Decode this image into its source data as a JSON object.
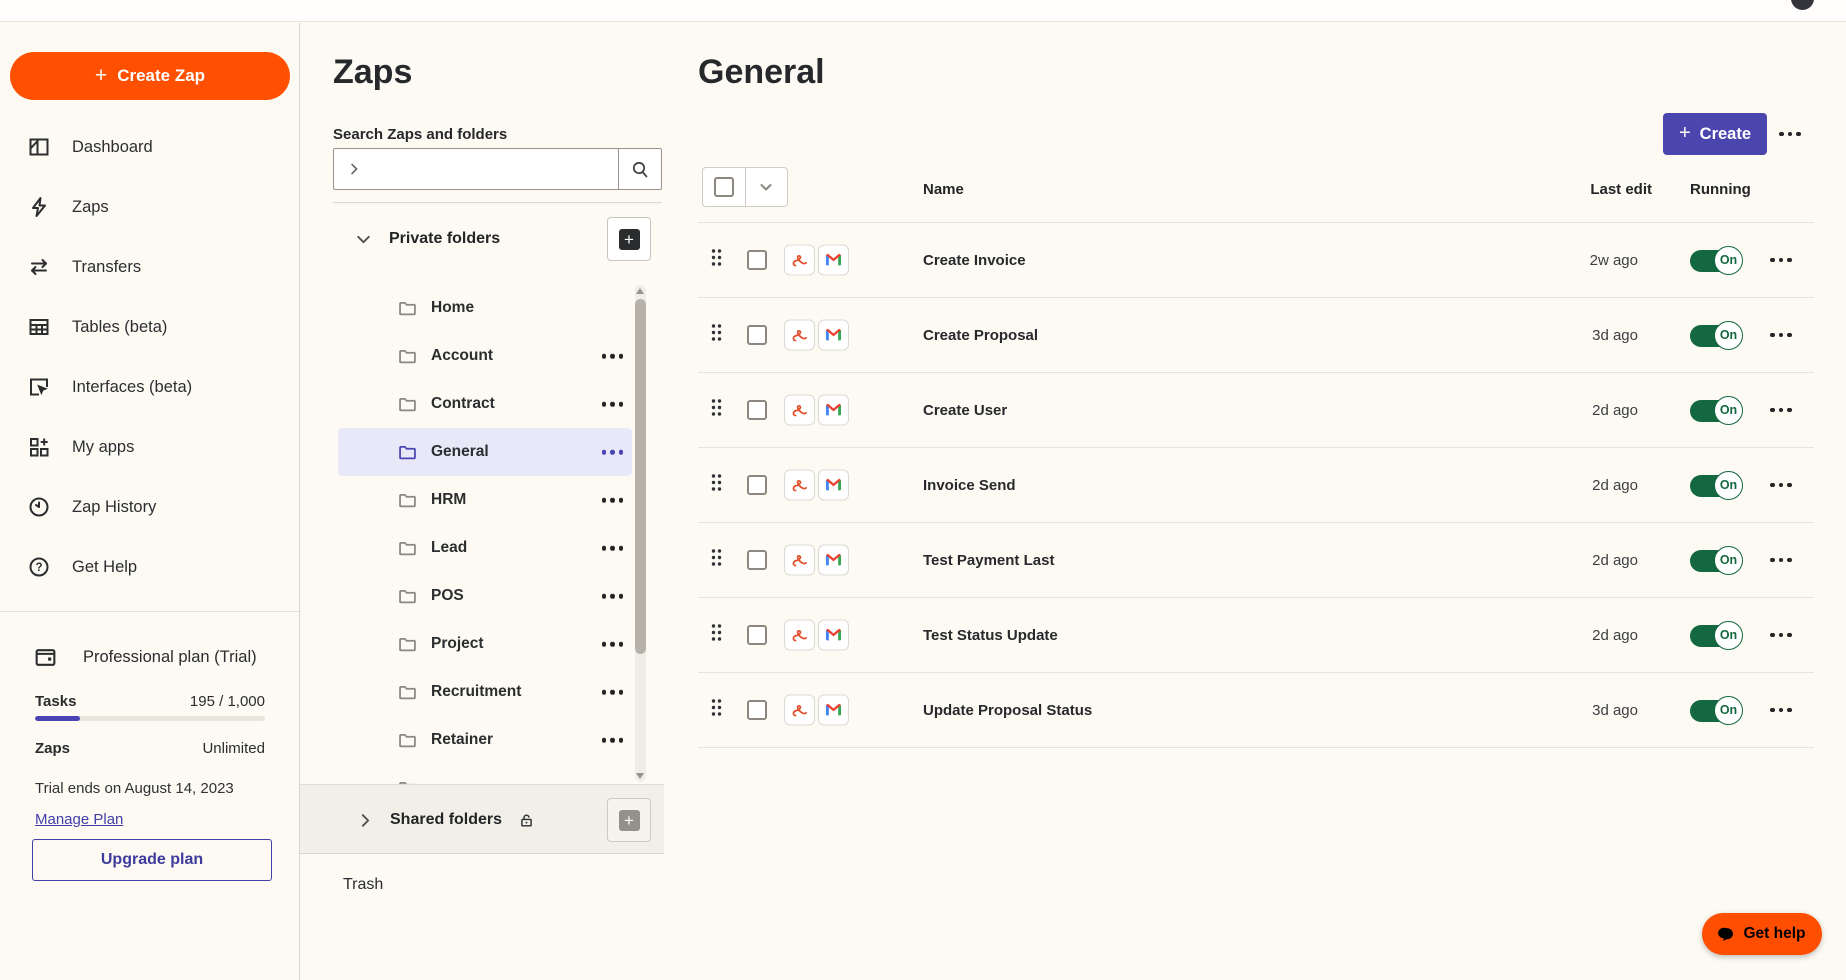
{
  "topbar": {
    "avatar_name": "user-avatar"
  },
  "sidebar": {
    "create_zap": "Create Zap",
    "nav": [
      {
        "label": "Dashboard"
      },
      {
        "label": "Zaps"
      },
      {
        "label": "Transfers"
      },
      {
        "label": "Tables (beta)"
      },
      {
        "label": "Interfaces (beta)"
      },
      {
        "label": "My apps"
      },
      {
        "label": "Zap History"
      },
      {
        "label": "Get Help"
      }
    ],
    "plan": {
      "name": "Professional plan (Trial)",
      "tasks_label": "Tasks",
      "tasks_value": "195 / 1,000",
      "tasks_percent": 19.5,
      "zaps_label": "Zaps",
      "zaps_value": "Unlimited",
      "trial_note": "Trial ends on August 14, 2023",
      "manage_plan": "Manage Plan",
      "upgrade": "Upgrade plan"
    }
  },
  "folders_panel": {
    "title": "Zaps",
    "search_label": "Search Zaps and folders",
    "search_value": "",
    "private_header": "Private folders",
    "shared_header": "Shared folders",
    "folders": [
      {
        "name": "Home"
      },
      {
        "name": "Account"
      },
      {
        "name": "Contract"
      },
      {
        "name": "General"
      },
      {
        "name": "HRM"
      },
      {
        "name": "Lead"
      },
      {
        "name": "POS"
      },
      {
        "name": "Project"
      },
      {
        "name": "Recruitment"
      },
      {
        "name": "Retainer"
      },
      {
        "name": ""
      }
    ],
    "selected_folder": "General",
    "trash": "Trash"
  },
  "main": {
    "title": "General",
    "create_button": "Create",
    "columns": {
      "name": "Name",
      "last_edit": "Last edit",
      "running": "Running"
    },
    "rows": [
      {
        "name": "Create Invoice",
        "last_edit": "2w ago",
        "running": "On"
      },
      {
        "name": "Create Proposal",
        "last_edit": "3d ago",
        "running": "On"
      },
      {
        "name": "Create User",
        "last_edit": "2d ago",
        "running": "On"
      },
      {
        "name": "Invoice Send",
        "last_edit": "2d ago",
        "running": "On"
      },
      {
        "name": "Test Payment Last",
        "last_edit": "2d ago",
        "running": "On"
      },
      {
        "name": "Test Status Update",
        "last_edit": "2d ago",
        "running": "On"
      },
      {
        "name": "Update Proposal Status",
        "last_edit": "3d ago",
        "running": "On"
      }
    ],
    "row_app_icons": [
      "pdf-app-icon",
      "gmail-icon"
    ]
  },
  "help_button": {
    "label": "Get help"
  },
  "colors": {
    "brand_orange": "#ff4f00",
    "primary_indigo": "#4b46ae",
    "toggle_green": "#14683f",
    "selected_row_bg": "#e9e8f8",
    "background_cream": "#fcfaf3"
  }
}
